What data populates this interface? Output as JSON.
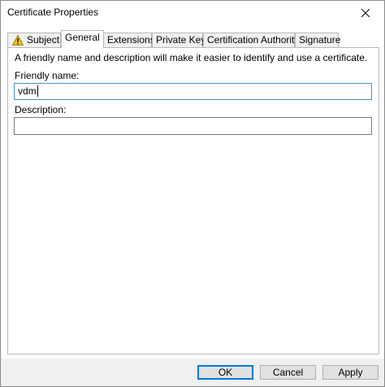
{
  "window": {
    "title": "Certificate Properties"
  },
  "tabs": [
    {
      "label": "Subject",
      "icon": "warning-icon"
    },
    {
      "label": "General"
    },
    {
      "label": "Extensions"
    },
    {
      "label": "Private Key"
    },
    {
      "label": "Certification Authority"
    },
    {
      "label": "Signature"
    }
  ],
  "active_tab": "General",
  "general": {
    "intro": "A friendly name and description will make it easier to identify and use a certificate.",
    "friendly_name_label": "Friendly name:",
    "friendly_name_value": "vdm",
    "description_label": "Description:",
    "description_value": ""
  },
  "buttons": {
    "ok": "OK",
    "cancel": "Cancel",
    "apply": "Apply"
  },
  "colors": {
    "focus_border": "#0078d7",
    "warning": "#f5c400"
  }
}
